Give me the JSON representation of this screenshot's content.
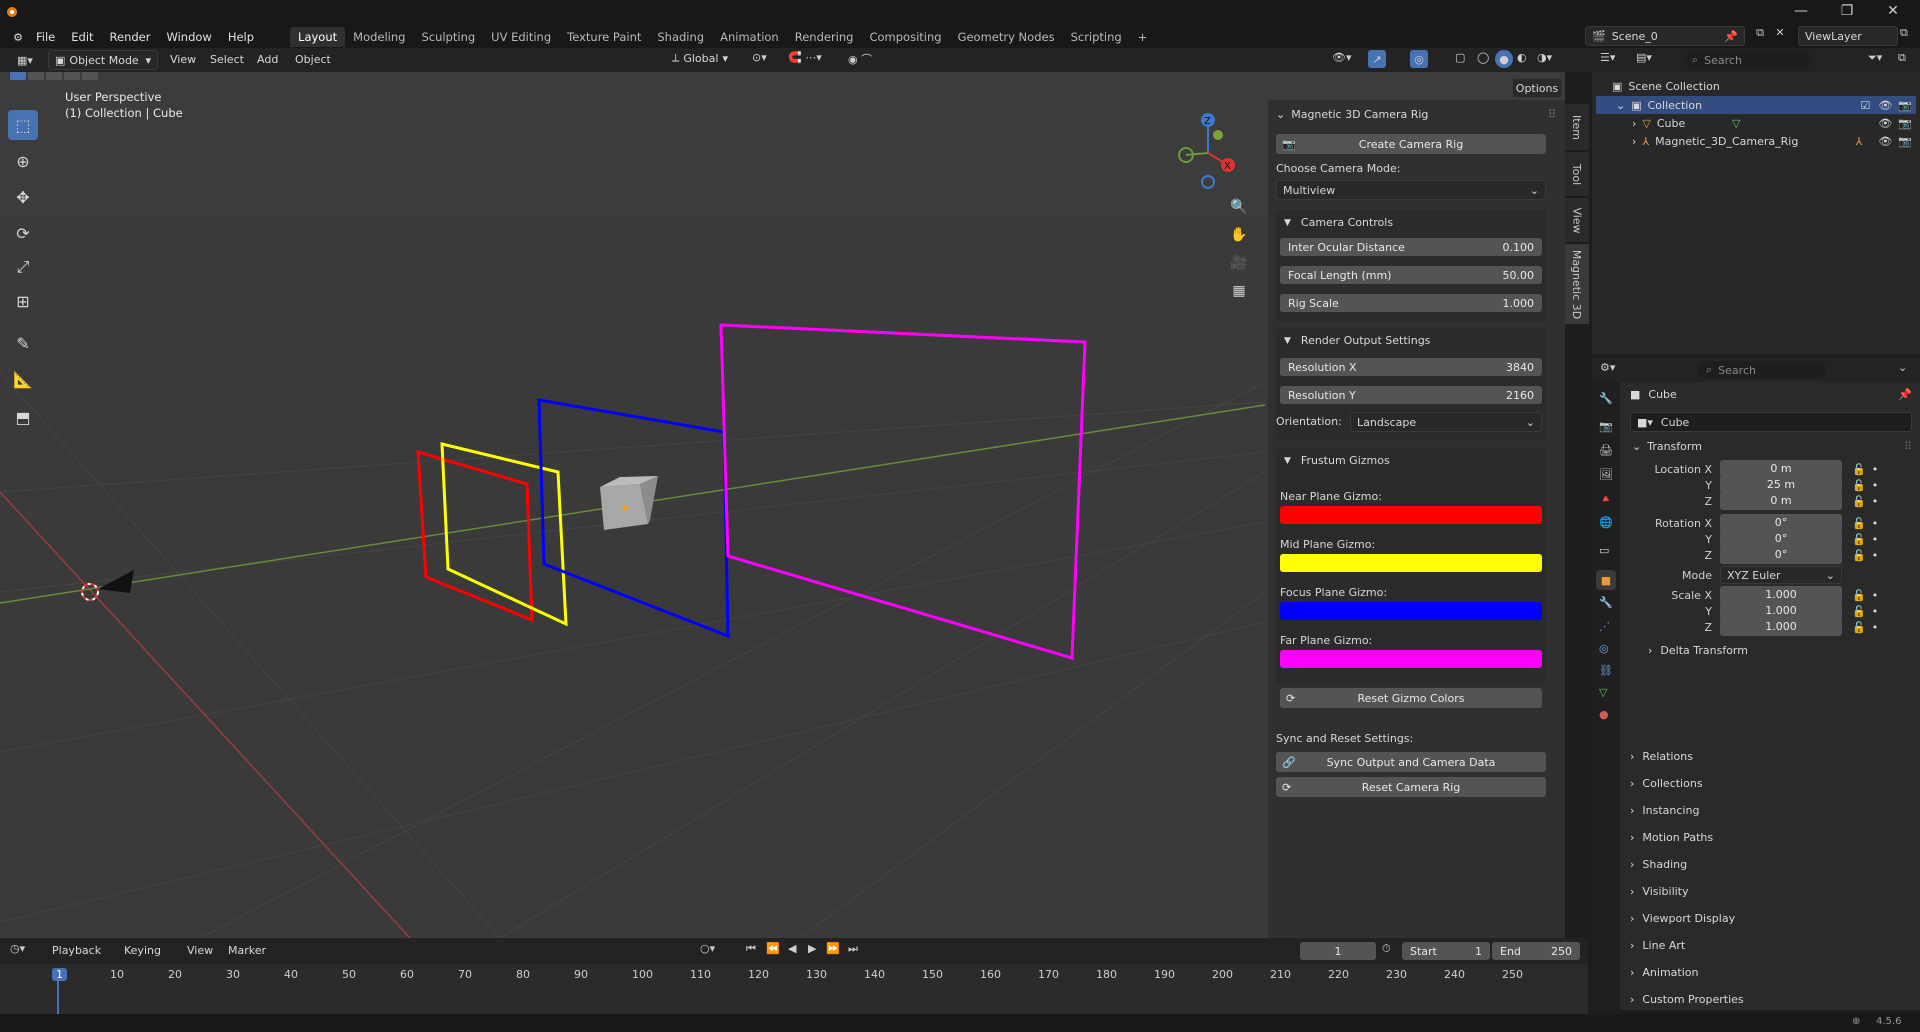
{
  "menu": {
    "items": [
      "File",
      "Edit",
      "Render",
      "Window",
      "Help"
    ],
    "workspaces": [
      "Layout",
      "Modeling",
      "Sculpting",
      "UV Editing",
      "Texture Paint",
      "Shading",
      "Animation",
      "Rendering",
      "Compositing",
      "Geometry Nodes",
      "Scripting"
    ],
    "active_workspace": "Layout",
    "add_tab": "+",
    "scene": "Scene_0",
    "view_layer": "ViewLayer"
  },
  "viewport_header": {
    "mode": "Object Mode",
    "menus": [
      "View",
      "Select",
      "Add",
      "Object"
    ],
    "transform_orientation": "Global",
    "options": "Options"
  },
  "viewport": {
    "overlay_title": "User Perspective",
    "overlay_subtitle": "(1) Collection | Cube",
    "gizmo_axes": {
      "z": "Z",
      "x": "X"
    },
    "colors": {
      "near": "#ff0000",
      "mid": "#ffff00",
      "focus": "#0000ff",
      "far": "#ff00ff"
    }
  },
  "side_tabs": [
    "Item",
    "Tool",
    "View",
    "Magnetic 3D"
  ],
  "addon_panel": {
    "title": "Magnetic 3D Camera Rig",
    "create_button": "Create Camera Rig",
    "camera_mode_label": "Choose Camera Mode:",
    "camera_mode_value": "Multiview",
    "camera_controls": {
      "title": "Camera Controls",
      "fields": [
        {
          "label": "Inter Ocular Distance",
          "value": "0.100"
        },
        {
          "label": "Focal Length (mm)",
          "value": "50.00"
        },
        {
          "label": "Rig Scale",
          "value": "1.000"
        }
      ]
    },
    "render_output": {
      "title": "Render Output Settings",
      "fields": [
        {
          "label": "Resolution X",
          "value": "3840"
        },
        {
          "label": "Resolution Y",
          "value": "2160"
        }
      ],
      "orientation_label": "Orientation:",
      "orientation_value": "Landscape"
    },
    "frustum": {
      "title": "Frustum Gizmos",
      "items": [
        {
          "label": "Near Plane Gizmo:",
          "color": "#ff0000"
        },
        {
          "label": "Mid Plane Gizmo:",
          "color": "#ffff00"
        },
        {
          "label": "Focus Plane Gizmo:",
          "color": "#0000ff"
        },
        {
          "label": "Far Plane Gizmo:",
          "color": "#ff00ff"
        }
      ],
      "reset_button": "Reset Gizmo Colors"
    },
    "sync_label": "Sync and Reset Settings:",
    "sync_button": "Sync Output and Camera Data",
    "reset_rig_button": "Reset Camera Rig"
  },
  "outliner": {
    "search_placeholder": "Search",
    "scene_collection": "Scene Collection",
    "collection": "Collection",
    "items": [
      "Cube",
      "Magnetic_3D_Camera_Rig"
    ]
  },
  "properties": {
    "search_placeholder": "Search",
    "object_name": "Cube",
    "object_field": "Cube",
    "transform_title": "Transform",
    "location": {
      "label": "Location X",
      "x": "0 m",
      "y": "25 m",
      "z": "0 m"
    },
    "rotation": {
      "label": "Rotation X",
      "x": "0°",
      "y": "0°",
      "z": "0°"
    },
    "axis_labels": {
      "y": "Y",
      "z": "Z"
    },
    "mode_label": "Mode",
    "mode_value": "XYZ Euler",
    "scale": {
      "label": "Scale X",
      "x": "1.000",
      "y": "1.000",
      "z": "1.000"
    },
    "delta": "Delta Transform",
    "sections": [
      "Relations",
      "Collections",
      "Instancing",
      "Motion Paths",
      "Shading",
      "Visibility",
      "Viewport Display",
      "Line Art",
      "Animation",
      "Custom Properties"
    ]
  },
  "timeline": {
    "menus": [
      "Playback",
      "Keying",
      "View",
      "Marker"
    ],
    "current_frame": "1",
    "start_label": "Start",
    "start_value": "1",
    "end_label": "End",
    "end_value": "250",
    "ticks": [
      "1",
      "10",
      "20",
      "30",
      "40",
      "50",
      "60",
      "70",
      "80",
      "90",
      "100",
      "110",
      "120",
      "130",
      "140",
      "150",
      "160",
      "170",
      "180",
      "190",
      "200",
      "210",
      "220",
      "230",
      "240",
      "250"
    ]
  },
  "status": {
    "version": "4.5.6"
  }
}
